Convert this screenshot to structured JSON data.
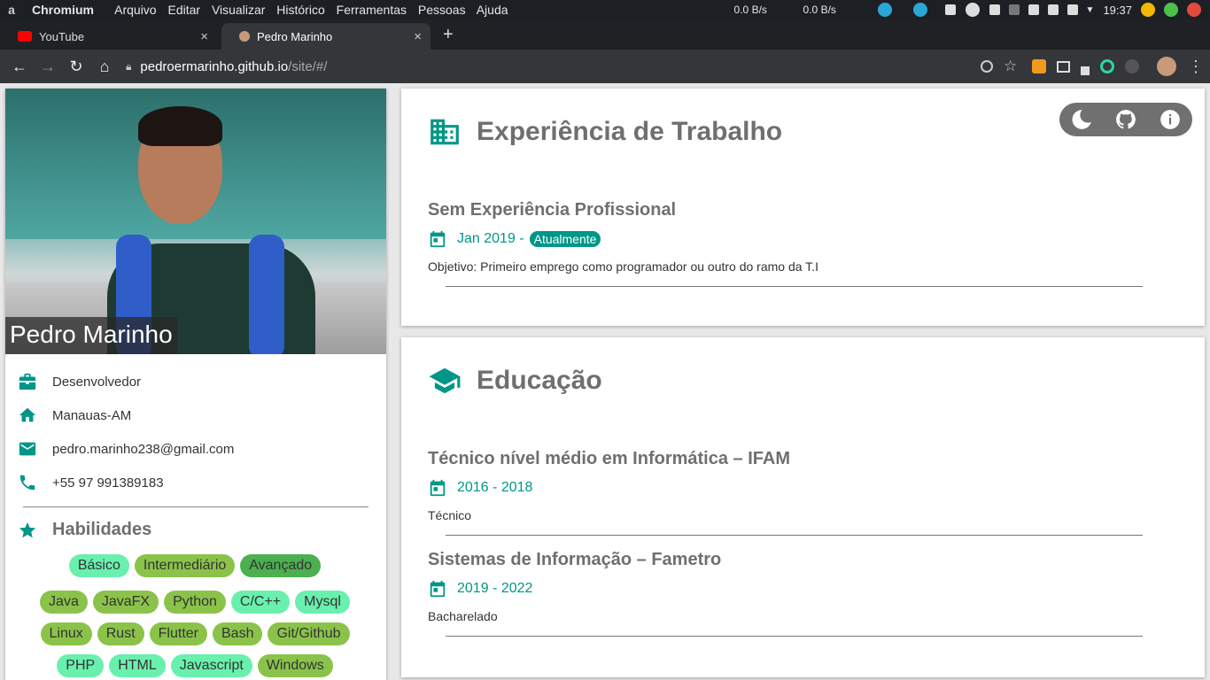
{
  "os": {
    "logo": "a",
    "app": "Chromium",
    "menu": [
      "Arquivo",
      "Editar",
      "Visualizar",
      "Histórico",
      "Ferramentas",
      "Pessoas",
      "Ajuda"
    ],
    "net_down": "0.0 B/s",
    "net_up": "0.0 B/s",
    "clock": "19:37"
  },
  "tabs": [
    {
      "title": "YouTube",
      "close": "×"
    },
    {
      "title": "Pedro Marinho",
      "close": "×"
    }
  ],
  "new_tab": "+",
  "address": {
    "host": "pedroermarinho.github.io",
    "path": "/site/#/"
  },
  "profile": {
    "name": "Pedro Marinho",
    "info": [
      {
        "icon": "briefcase-icon",
        "text": "Desenvolvedor"
      },
      {
        "icon": "home-icon",
        "text": "Manauas-AM"
      },
      {
        "icon": "mail-icon",
        "text": "pedro.marinho238@gmail.com"
      },
      {
        "icon": "phone-icon",
        "text": "+55 97 991389183"
      }
    ],
    "skills_title": "Habilidades",
    "levels": [
      "Básico",
      "Intermediário",
      "Avançado"
    ],
    "skills_rows": [
      [
        [
          "Java",
          "inter"
        ],
        [
          "JavaFX",
          "inter"
        ],
        [
          "Python",
          "inter"
        ],
        [
          "C/C++",
          "basic"
        ],
        [
          "Mysql",
          "basic"
        ]
      ],
      [
        [
          "Linux",
          "inter"
        ],
        [
          "Rust",
          "inter"
        ],
        [
          "Flutter",
          "inter"
        ],
        [
          "Bash",
          "inter"
        ],
        [
          "Git/Github",
          "inter"
        ]
      ],
      [
        [
          "PHP",
          "basic"
        ],
        [
          "HTML",
          "basic"
        ],
        [
          "Javascript",
          "basic"
        ],
        [
          "Windows",
          "inter"
        ]
      ]
    ]
  },
  "experience": {
    "title": "Experiência de Trabalho",
    "entries": [
      {
        "heading": "Sem Experiência Profissional",
        "date": "Jan 2019 -",
        "badge": "Atualmente",
        "desc": "Objetivo: Primeiro emprego como programador ou outro do ramo da T.I"
      }
    ]
  },
  "education": {
    "title": "Educação",
    "entries": [
      {
        "heading": "Técnico nível médio em Informática – IFAM",
        "date": "2016 - 2018",
        "desc": "Técnico"
      },
      {
        "heading": "Sistemas de Informação – Fametro",
        "date": "2019 - 2022",
        "desc": "Bacharelado"
      }
    ]
  },
  "colors": {
    "accent": "#009688",
    "basic": "#69f0ae",
    "intermediate": "#8bc34a",
    "advanced": "#4caf50"
  }
}
